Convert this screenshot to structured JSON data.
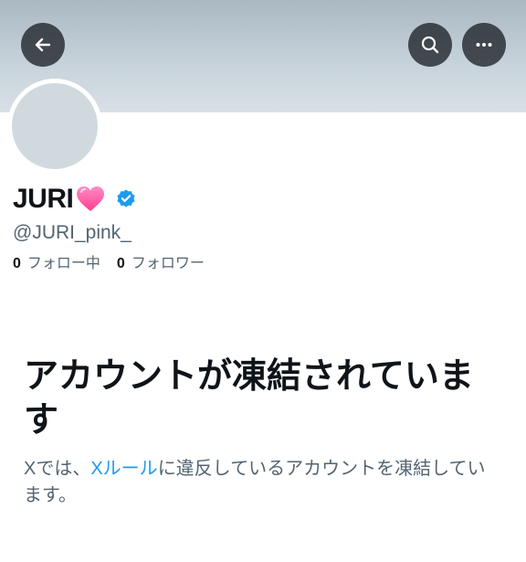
{
  "header": {
    "back_icon": "arrow-left-icon",
    "search_icon": "search-icon",
    "more_icon": "more-horizontal-icon",
    "icon_color": "#ffffff",
    "button_bg": "#0f1419"
  },
  "profile": {
    "display_name": "JURI",
    "name_emoji": "pink-heart-icon",
    "verified_icon": "verified-badge-icon",
    "handle": "@JURI_pink_",
    "following_count": "0",
    "following_label": "フォロー中",
    "followers_count": "0",
    "followers_label": "フォロワー"
  },
  "suspended": {
    "title": "アカウントが凍結されています",
    "body_prefix": "Xでは、",
    "rules_link": "Xルール",
    "body_suffix": "に違反しているアカウントを凍結しています。"
  },
  "colors": {
    "accent": "#1d9bf0",
    "text_primary": "#0f1419",
    "text_secondary": "#536471",
    "heart": "#ff5fa2"
  }
}
